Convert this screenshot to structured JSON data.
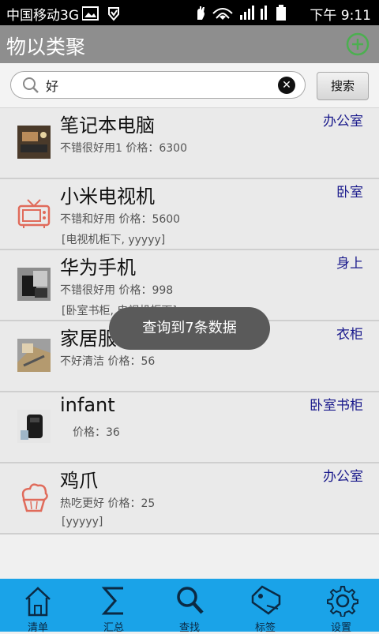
{
  "statusbar": {
    "carrier": "中国移动3G",
    "time": "下午 9:11"
  },
  "appbar": {
    "title": "物以类聚",
    "add_icon": "add-circle-icon",
    "accent": "#4caf50"
  },
  "search": {
    "value": "好",
    "button_label": "搜索"
  },
  "items": [
    {
      "name": "笔记本电脑",
      "location": "办公室",
      "detail": "不错很好用1    价格：6300",
      "tags": ""
    },
    {
      "name": "小米电视机",
      "location": "卧室",
      "detail": "不错和好用    价格：5600",
      "tags": "[电视机柜下, yyyyy]"
    },
    {
      "name": "华为手机",
      "location": "身上",
      "detail": "不错很好用    价格：998",
      "tags": "[卧室书柜, 电视机柜下]"
    },
    {
      "name": "家居服",
      "location": "衣柜",
      "detail": "不好清洁    价格：56",
      "tags": ""
    },
    {
      "name": "infant",
      "location": "卧室书柜",
      "detail": "价格：36",
      "tags": ""
    },
    {
      "name": "鸡爪",
      "location": "办公室",
      "detail": "热吃更好    价格：25",
      "tags": "[yyyyy]"
    }
  ],
  "toast": "查询到7条数据",
  "nav": {
    "tabs": [
      {
        "label": "清单",
        "icon": "home-icon"
      },
      {
        "label": "汇总",
        "icon": "sigma-icon"
      },
      {
        "label": "查找",
        "icon": "search-icon"
      },
      {
        "label": "标签",
        "icon": "tag-icon"
      },
      {
        "label": "设置",
        "icon": "gear-icon"
      }
    ],
    "bar_color": "#1aa3e8"
  }
}
